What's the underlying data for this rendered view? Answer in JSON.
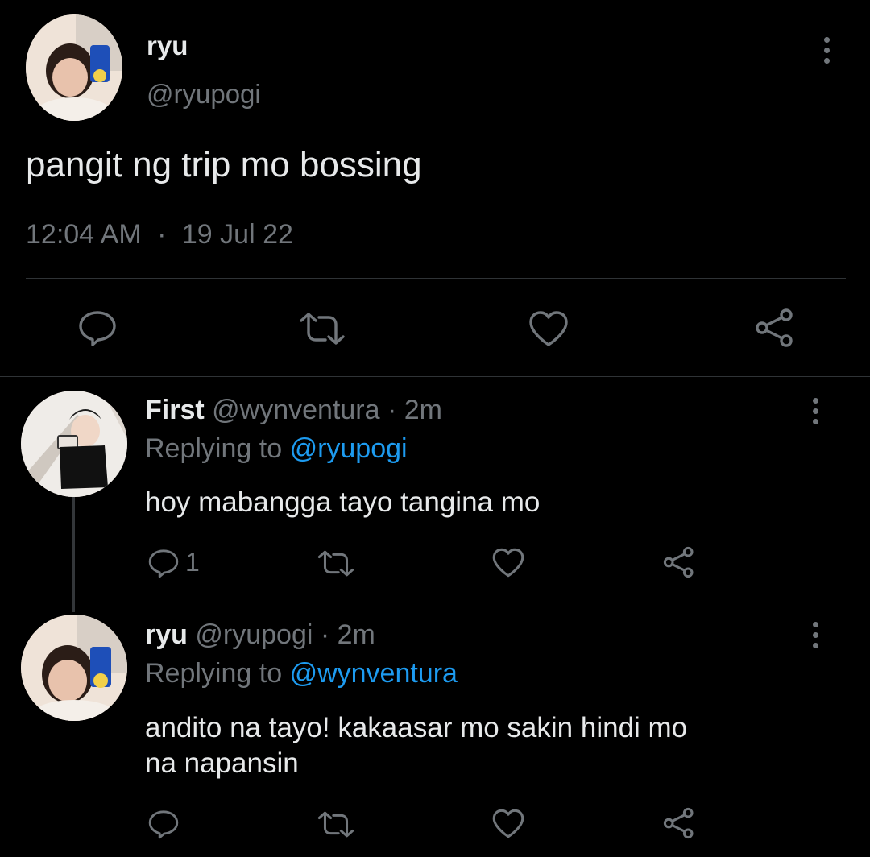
{
  "main_tweet": {
    "display_name": "ryu",
    "handle": "@ryupogi",
    "text": "pangit ng trip mo bossing",
    "time": "12:04 AM",
    "separator": "·",
    "date": "19 Jul 22"
  },
  "replies": [
    {
      "display_name": "First",
      "handle": "@wynventura",
      "dot": "·",
      "age": "2m",
      "replying_prefix": "Replying to",
      "replying_to": "@ryupogi",
      "text": "hoy mabangga tayo tangina mo",
      "reply_count": "1"
    },
    {
      "display_name": "ryu",
      "handle": "@ryupogi",
      "dot": "·",
      "age": "2m",
      "replying_prefix": "Replying to",
      "replying_to": "@wynventura",
      "text_line1": "andito na tayo! kakaasar mo sakin hindi mo",
      "text_line2": "na napansin"
    }
  ],
  "icons": [
    "comment-icon",
    "retweet-icon",
    "like-icon",
    "share-icon",
    "more-icon"
  ],
  "colors": {
    "background": "#000000",
    "text": "#e7e9ea",
    "muted": "#71767b",
    "link": "#1d9bf0",
    "divider": "#2f3336"
  }
}
